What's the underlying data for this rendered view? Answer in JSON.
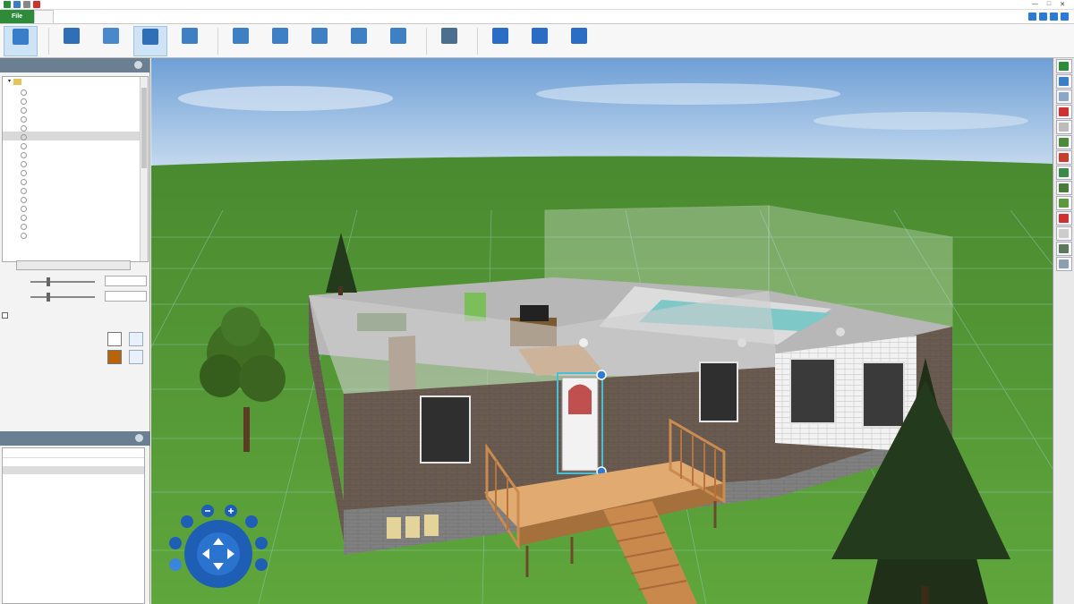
{
  "titlebar": {
    "title": "",
    "window_controls": [
      "—",
      "□",
      "✕"
    ]
  },
  "menu": {
    "file": "File",
    "tabs": [
      "",
      "",
      "",
      "",
      "",
      ""
    ],
    "active_tab_index": 0
  },
  "ribbon": {
    "buttons": [
      {
        "label": "",
        "icon": "select-icon",
        "color": "#3a7dc9",
        "selected": true
      },
      {
        "label": "",
        "icon": "wall-icon",
        "color": "#2f6fb8"
      },
      {
        "label": "",
        "icon": "window-icon",
        "color": "#4a88cc"
      },
      {
        "label": "",
        "icon": "door-icon",
        "color": "#2f6fb8",
        "selected": true
      },
      {
        "label": "",
        "icon": "floor-icon",
        "color": "#3f7fc3"
      },
      {
        "label": "",
        "icon": "ceiling-icon",
        "color": "#3f7fc3"
      },
      {
        "label": "",
        "icon": "roof-icon",
        "color": "#3f7fc3"
      },
      {
        "label": "",
        "icon": "stairs-icon",
        "color": "#3f7fc3"
      },
      {
        "label": "",
        "icon": "railing-icon",
        "color": "#3f7fc3"
      },
      {
        "label": "",
        "icon": "deck-icon",
        "color": "#3f7fc3"
      },
      {
        "label": "",
        "icon": "paint-icon",
        "color": "#4d6f8f"
      },
      {
        "label": "",
        "icon": "add-content-icon",
        "color": "#2b6cc4"
      },
      {
        "label": "",
        "icon": "update-icon",
        "color": "#2b6cc4"
      },
      {
        "label": "",
        "icon": "upgrade-icon",
        "color": "#2b6cc4"
      }
    ]
  },
  "door_properties": {
    "header": "",
    "tree_root": "",
    "tree_items": [
      "",
      "",
      "",
      "",
      "",
      "",
      "",
      "",
      "",
      "",
      "",
      "",
      "",
      "",
      "",
      "",
      ""
    ],
    "selected_index": 5,
    "search_button": "",
    "width_label": "",
    "width_value": "",
    "height_label": "",
    "height_value": "",
    "checkbox_label": "",
    "material1_label": "",
    "material1_color": "#ffffff",
    "material2_label": "",
    "material2_color": "#b8640c"
  },
  "story_panel": {
    "header": "",
    "columns": [
      "",
      "",
      ""
    ],
    "rows": [
      {
        "name": "",
        "v1": "",
        "v2": ""
      },
      {
        "name": "",
        "v1": "",
        "v2": ""
      },
      {
        "name": "",
        "v1": "",
        "v2": ""
      },
      {
        "name": "",
        "v1": "",
        "v2": ""
      },
      {
        "name": "",
        "v1": "",
        "v2": ""
      },
      {
        "name": "",
        "v1": "",
        "v2": ""
      }
    ],
    "selected_row": 1
  },
  "right_toolbar": {
    "buttons": [
      {
        "icon": "view-2d-icon",
        "color": "#2e8b3a"
      },
      {
        "icon": "view-3d-icon",
        "color": "#3a7dc9"
      },
      {
        "icon": "cloud-icon",
        "color": "#8aa7c7"
      },
      {
        "icon": "delete-icon",
        "color": "#d03030"
      },
      {
        "icon": "copy-icon",
        "color": "#bbbbbb"
      },
      {
        "icon": "terrain-icon",
        "color": "#4b8a3a"
      },
      {
        "icon": "plant-icon",
        "color": "#c83c2c"
      },
      {
        "icon": "landscape-icon",
        "color": "#3a8a4a"
      },
      {
        "icon": "tree-icon",
        "color": "#4a7a3a"
      },
      {
        "icon": "grass-icon",
        "color": "#5a9a3a"
      },
      {
        "icon": "no-entry-icon",
        "color": "#d03030"
      },
      {
        "icon": "document-icon",
        "color": "#cccccc"
      },
      {
        "icon": "camera-icon",
        "color": "#5a7a5a"
      },
      {
        "icon": "dimension-icon",
        "color": "#8aa0b0"
      }
    ]
  },
  "colors": {
    "file_tab": "#2e8b3a",
    "panel_header": "#6b7f93",
    "sky": "#8fb6e0",
    "grass": "#5aa03c",
    "brick": "#6e5f55",
    "deck": "#d9a064"
  }
}
